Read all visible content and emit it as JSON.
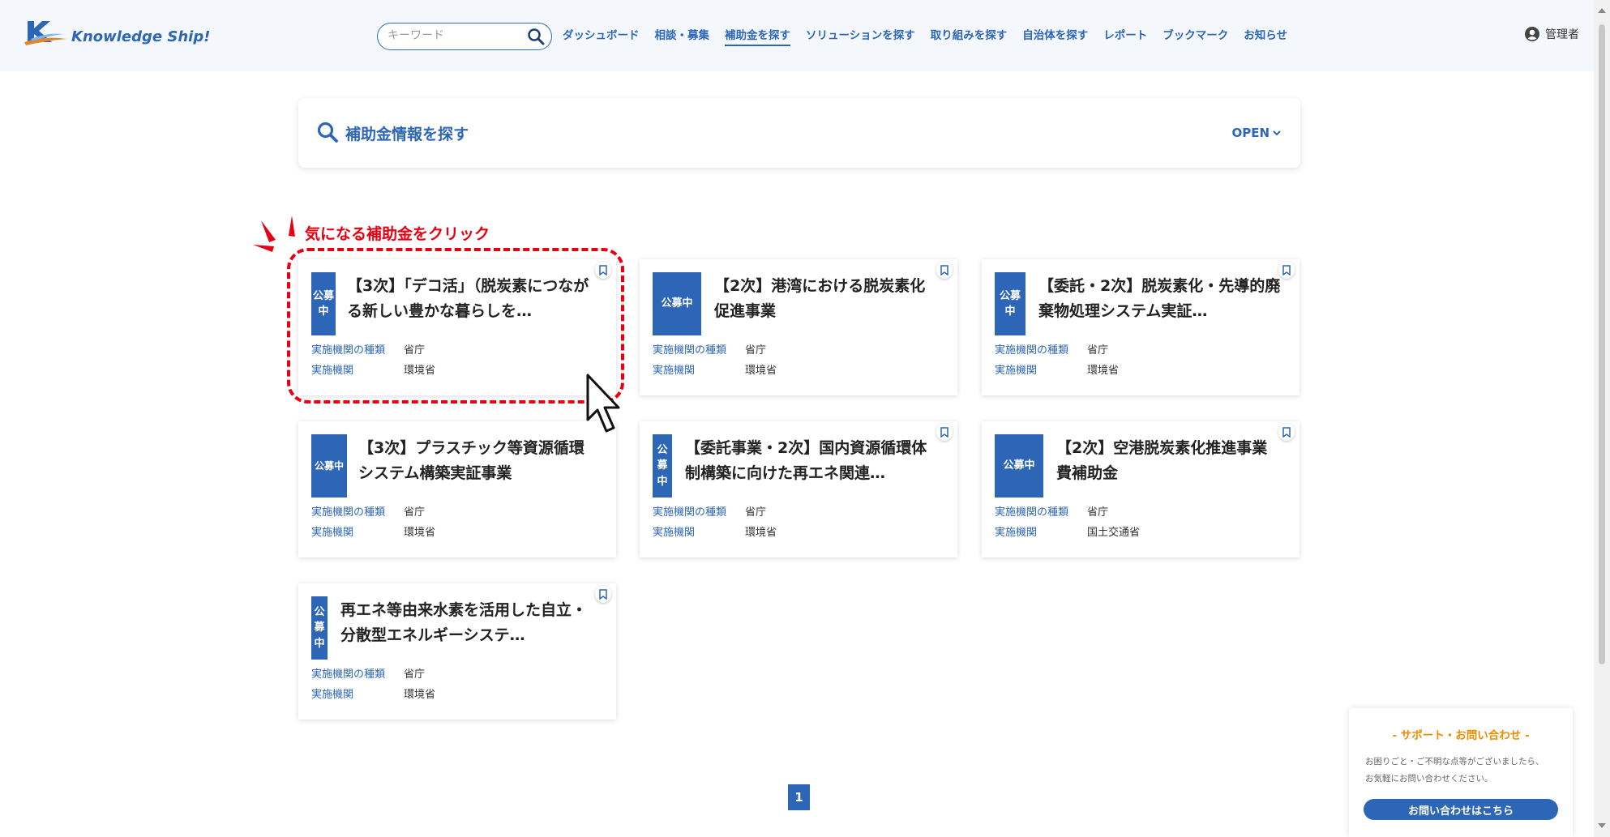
{
  "header": {
    "logo_text": "Knowledge Ship!",
    "search_placeholder": "キーワード",
    "nav": [
      {
        "label": "ダッシュボード"
      },
      {
        "label": "相談・募集"
      },
      {
        "label": "補助金を探す",
        "active": true
      },
      {
        "label": "ソリューションを探す"
      },
      {
        "label": "取り組みを探す"
      },
      {
        "label": "自治体を探す"
      },
      {
        "label": "レポート"
      },
      {
        "label": "ブックマーク"
      },
      {
        "label": "お知らせ"
      }
    ],
    "user_label": "管理者"
  },
  "search_panel": {
    "title": "補助金情報を探す",
    "open_label": "OPEN"
  },
  "annotation": {
    "text": "気になる補助金をクリック"
  },
  "meta_labels": {
    "type": "実施機関の種類",
    "org": "実施機関"
  },
  "cards": [
    {
      "status": "公募中",
      "title": "【3次】「デコ活」（脱炭素につながる新しい豊かな暮らしを…",
      "type": "省庁",
      "org": "環境省"
    },
    {
      "status": "公募中",
      "title": "【2次】港湾における脱炭素化促進事業",
      "type": "省庁",
      "org": "環境省"
    },
    {
      "status": "公募中",
      "title": "【委託・2次】脱炭素化・先導的廃棄物処理システム実証…",
      "type": "省庁",
      "org": "環境省"
    },
    {
      "status": "公募中",
      "title": "【3次】プラスチック等資源循環システム構築実証事業",
      "type": "省庁",
      "org": "環境省"
    },
    {
      "status": "公募中",
      "title": "【委託事業・2次】国内資源循環体制構築に向けた再エネ関連…",
      "type": "省庁",
      "org": "環境省"
    },
    {
      "status": "公募中",
      "title": "【2次】空港脱炭素化推進事業費補助金",
      "type": "省庁",
      "org": "国土交通省"
    },
    {
      "status": "公募中",
      "title": "再エネ等由来水素を活用した自立・分散型エネルギーシステ…",
      "type": "省庁",
      "org": "環境省"
    }
  ],
  "pagination": {
    "current": "1"
  },
  "support": {
    "title": "- サポート・お問い合わせ -",
    "body_line1": "お困りごと・ご不明な点等がございましたら、",
    "body_line2": "お気軽にお問い合わせください。",
    "button": "お問い合わせはこちら"
  },
  "colors": {
    "accent": "#2e66b7",
    "annotation": "#e60012",
    "support_title": "#f08c00",
    "header_bg": "#f4f8fd"
  }
}
